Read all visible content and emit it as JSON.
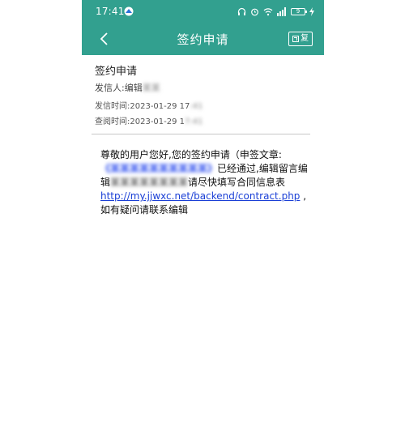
{
  "status_bar": {
    "time": "17:41",
    "battery": "9"
  },
  "header": {
    "title": "签约申请",
    "reply_label": "复"
  },
  "message": {
    "title": "签约申请",
    "sender_label": "发信人:编辑",
    "sender_name_blurred": "某某",
    "sent_time_label": "发信时间:2023-01-29 17",
    "sent_time_blurred": ":41",
    "read_time_label": "查阅时间:2023-01-29 1",
    "read_time_blurred": "7:41",
    "body_greeting": "尊敬的用户您好,您的签约申请（申签文章:",
    "work_title_blurred": "《某某某某某某某某某某》",
    "body_passed": "已经通过,",
    "body_editor_msg": "编辑留言编辑",
    "editor_msg_blurred": "某某某某某某某某",
    "body_fill": "请尽快填写合同信息表",
    "link_text": "http://my.jjwxc.net/backend/contract.php",
    "body_after_link": " ,",
    "body_contact": "如有疑问请联系编辑"
  },
  "colors": {
    "header_bg": "#32a08f",
    "link": "#1a3fd6"
  }
}
